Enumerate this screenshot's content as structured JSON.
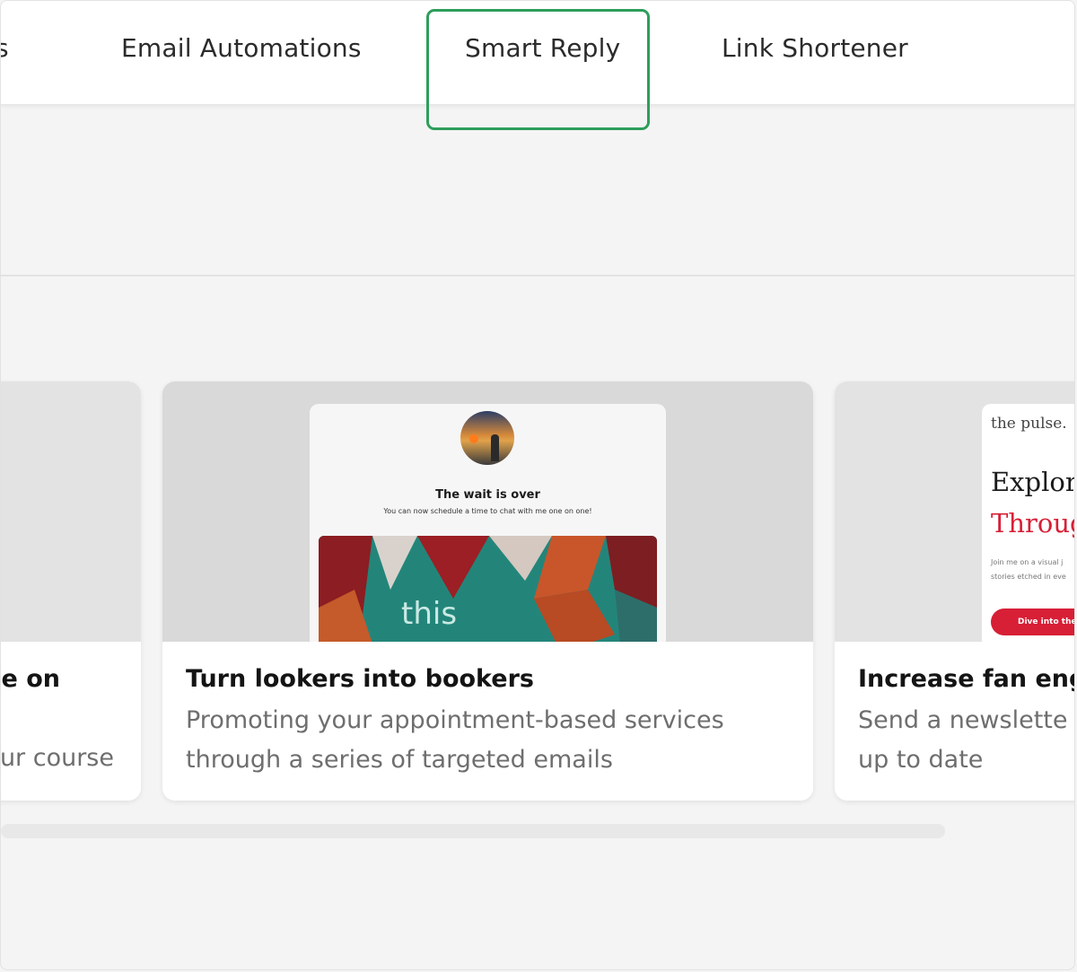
{
  "tabs": {
    "partial": "s",
    "email_automations": "Email Automations",
    "smart_reply": "Smart Reply",
    "link_shortener": "Link Shortener"
  },
  "cards": {
    "left": {
      "title": "se on",
      "desc_line2": "ur course"
    },
    "middle": {
      "title": "Turn lookers into bookers",
      "desc_line1": "Promoting your appointment-based services",
      "desc_line2": "through a series of targeted emails",
      "preview": {
        "heading": "The wait is over",
        "subheading": "You can now schedule a time to chat with me one on one!",
        "image_text": "this"
      }
    },
    "right": {
      "title": "Increase fan enga",
      "desc_line1": "Send a newslette",
      "desc_line2": "up to date",
      "preview": {
        "logo": "the pulse.",
        "headline1": "Explor",
        "headline2": "Throug",
        "text1": "Join me on a visual j",
        "text2": "stories etched in eve",
        "button": "Dive into the"
      }
    }
  },
  "colors": {
    "highlight": "#2e9e5b",
    "accent_red": "#d71f36"
  }
}
